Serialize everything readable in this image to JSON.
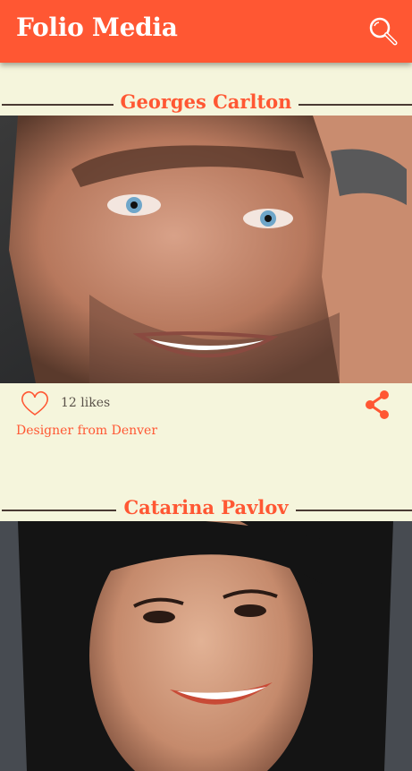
{
  "app": {
    "title": "Folio Media",
    "accent_color": "#ff5733",
    "background_color": "#f5f5dc"
  },
  "header_icons": {
    "search": "search-icon"
  },
  "posts": [
    {
      "name": "Georges Carlton",
      "likes": "12 likes",
      "bio": "Designer from Denver",
      "photo": "portrait-man-blue-eyes"
    },
    {
      "name": "Catarina Pavlov",
      "likes": "",
      "bio": "",
      "photo": "portrait-woman-smiling"
    }
  ]
}
